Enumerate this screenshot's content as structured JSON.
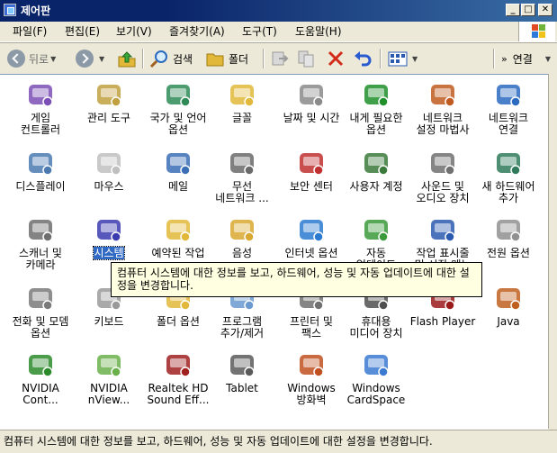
{
  "window": {
    "title": "제어판"
  },
  "window_buttons": {
    "minimize": "_",
    "maximize": "□",
    "close": "✕"
  },
  "menu": [
    "파일(F)",
    "편집(E)",
    "보기(V)",
    "즐겨찾기(A)",
    "도구(T)",
    "도움말(H)"
  ],
  "toolbar": {
    "back_label": "뒤로",
    "search_label": "검색",
    "folders_label": "폴더",
    "go_label": "연결"
  },
  "items": [
    {
      "label": "게임\n컨트롤러",
      "icon": "game-controller-icon",
      "color": "#7b4fb5"
    },
    {
      "label": "관리 도구",
      "icon": "admin-tools-icon",
      "color": "#c0a040"
    },
    {
      "label": "국가 및 언어\n옵션",
      "icon": "globe-icon",
      "color": "#2e8b57"
    },
    {
      "label": "글꼴",
      "icon": "fonts-folder-icon",
      "color": "#e2b83a"
    },
    {
      "label": "날짜 및 시간",
      "icon": "clock-icon",
      "color": "#8a8a8a"
    },
    {
      "label": "내게 필요한\n옵션",
      "icon": "accessibility-icon",
      "color": "#1f8f2a"
    },
    {
      "label": "네트워크\n설정 마법사",
      "icon": "network-house-icon",
      "color": "#c05a20"
    },
    {
      "label": "네트워크\n연결",
      "icon": "network-globe-icon",
      "color": "#2a6ac0"
    },
    {
      "label": "디스플레이",
      "icon": "display-icon",
      "color": "#4a7ab0"
    },
    {
      "label": "마우스",
      "icon": "mouse-icon",
      "color": "#bfbfbf"
    },
    {
      "label": "메일",
      "icon": "mail-icon",
      "color": "#3a6fb5"
    },
    {
      "label": "무선\n네트워크 ...",
      "icon": "wireless-icon",
      "color": "#6a6a6a"
    },
    {
      "label": "보안 센터",
      "icon": "shield-icon",
      "color": "#c03030"
    },
    {
      "label": "사용자 계정",
      "icon": "users-icon",
      "color": "#3a7a3a"
    },
    {
      "label": "사운드 및\n오디오 장치",
      "icon": "speaker-icon",
      "color": "#707070"
    },
    {
      "label": "새 하드웨어\n추가",
      "icon": "hardware-icon",
      "color": "#2f7a5a"
    },
    {
      "label": "스캐너 및\n카메라",
      "icon": "scanner-camera-icon",
      "color": "#6f6f6f"
    },
    {
      "label": "시스템",
      "icon": "system-icon",
      "color": "#3b3bb0",
      "selected": true
    },
    {
      "label": "예약된 작업",
      "icon": "scheduled-tasks-icon",
      "color": "#e2b83a"
    },
    {
      "label": "음성",
      "icon": "speech-icon",
      "color": "#d8a830"
    },
    {
      "label": "인터넷 옵션",
      "icon": "internet-options-icon",
      "color": "#2a7ad0"
    },
    {
      "label": "자동\n업데이트",
      "icon": "windows-update-icon",
      "color": "#3a9a3a"
    },
    {
      "label": "작업 표시줄\n및 시작 메뉴",
      "icon": "taskbar-icon",
      "color": "#2a5ab0"
    },
    {
      "label": "전원 옵션",
      "icon": "power-icon",
      "color": "#909090"
    },
    {
      "label": "전화 및 모뎀\n옵션",
      "icon": "phone-modem-icon",
      "color": "#7a7a7a"
    },
    {
      "label": "키보드",
      "icon": "keyboard-icon",
      "color": "#9a9a9a"
    },
    {
      "label": "폴더 옵션",
      "icon": "folder-options-icon",
      "color": "#e2b83a"
    },
    {
      "label": "프로그램\n추가/제거",
      "icon": "add-remove-programs-icon",
      "color": "#6a9ad0"
    },
    {
      "label": "프린터 및\n팩스",
      "icon": "printer-icon",
      "color": "#707070"
    },
    {
      "label": "휴대용\n미디어 장치",
      "icon": "portable-media-icon",
      "color": "#505050"
    },
    {
      "label": "Flash Player",
      "icon": "flash-player-icon",
      "color": "#9a1a1a"
    },
    {
      "label": "Java",
      "icon": "java-icon",
      "color": "#c06020"
    },
    {
      "label": "NVIDIA\nCont...",
      "icon": "nvidia-control-icon",
      "color": "#2a8a2a"
    },
    {
      "label": "NVIDIA\nnView...",
      "icon": "nvidia-nview-icon",
      "color": "#6ab04a"
    },
    {
      "label": "Realtek HD\nSound Eff...",
      "icon": "realtek-speaker-icon",
      "color": "#a02020"
    },
    {
      "label": "Tablet",
      "icon": "tablet-icon",
      "color": "#5a5a5a"
    },
    {
      "label": "Windows\n방화벽",
      "icon": "firewall-icon",
      "color": "#c05020"
    },
    {
      "label": "Windows\nCardSpace",
      "icon": "cardspace-icon",
      "color": "#3a7ad0"
    }
  ],
  "tooltip": "컴퓨터 시스템에 대한 정보를 보고, 하드웨어, 성능 및 자동 업데이트에 대한 설정을 변경합니다.",
  "status": "컴퓨터 시스템에 대한 정보를 보고, 하드웨어, 성능 및 자동 업데이트에 대한 설정을 변경합니다."
}
